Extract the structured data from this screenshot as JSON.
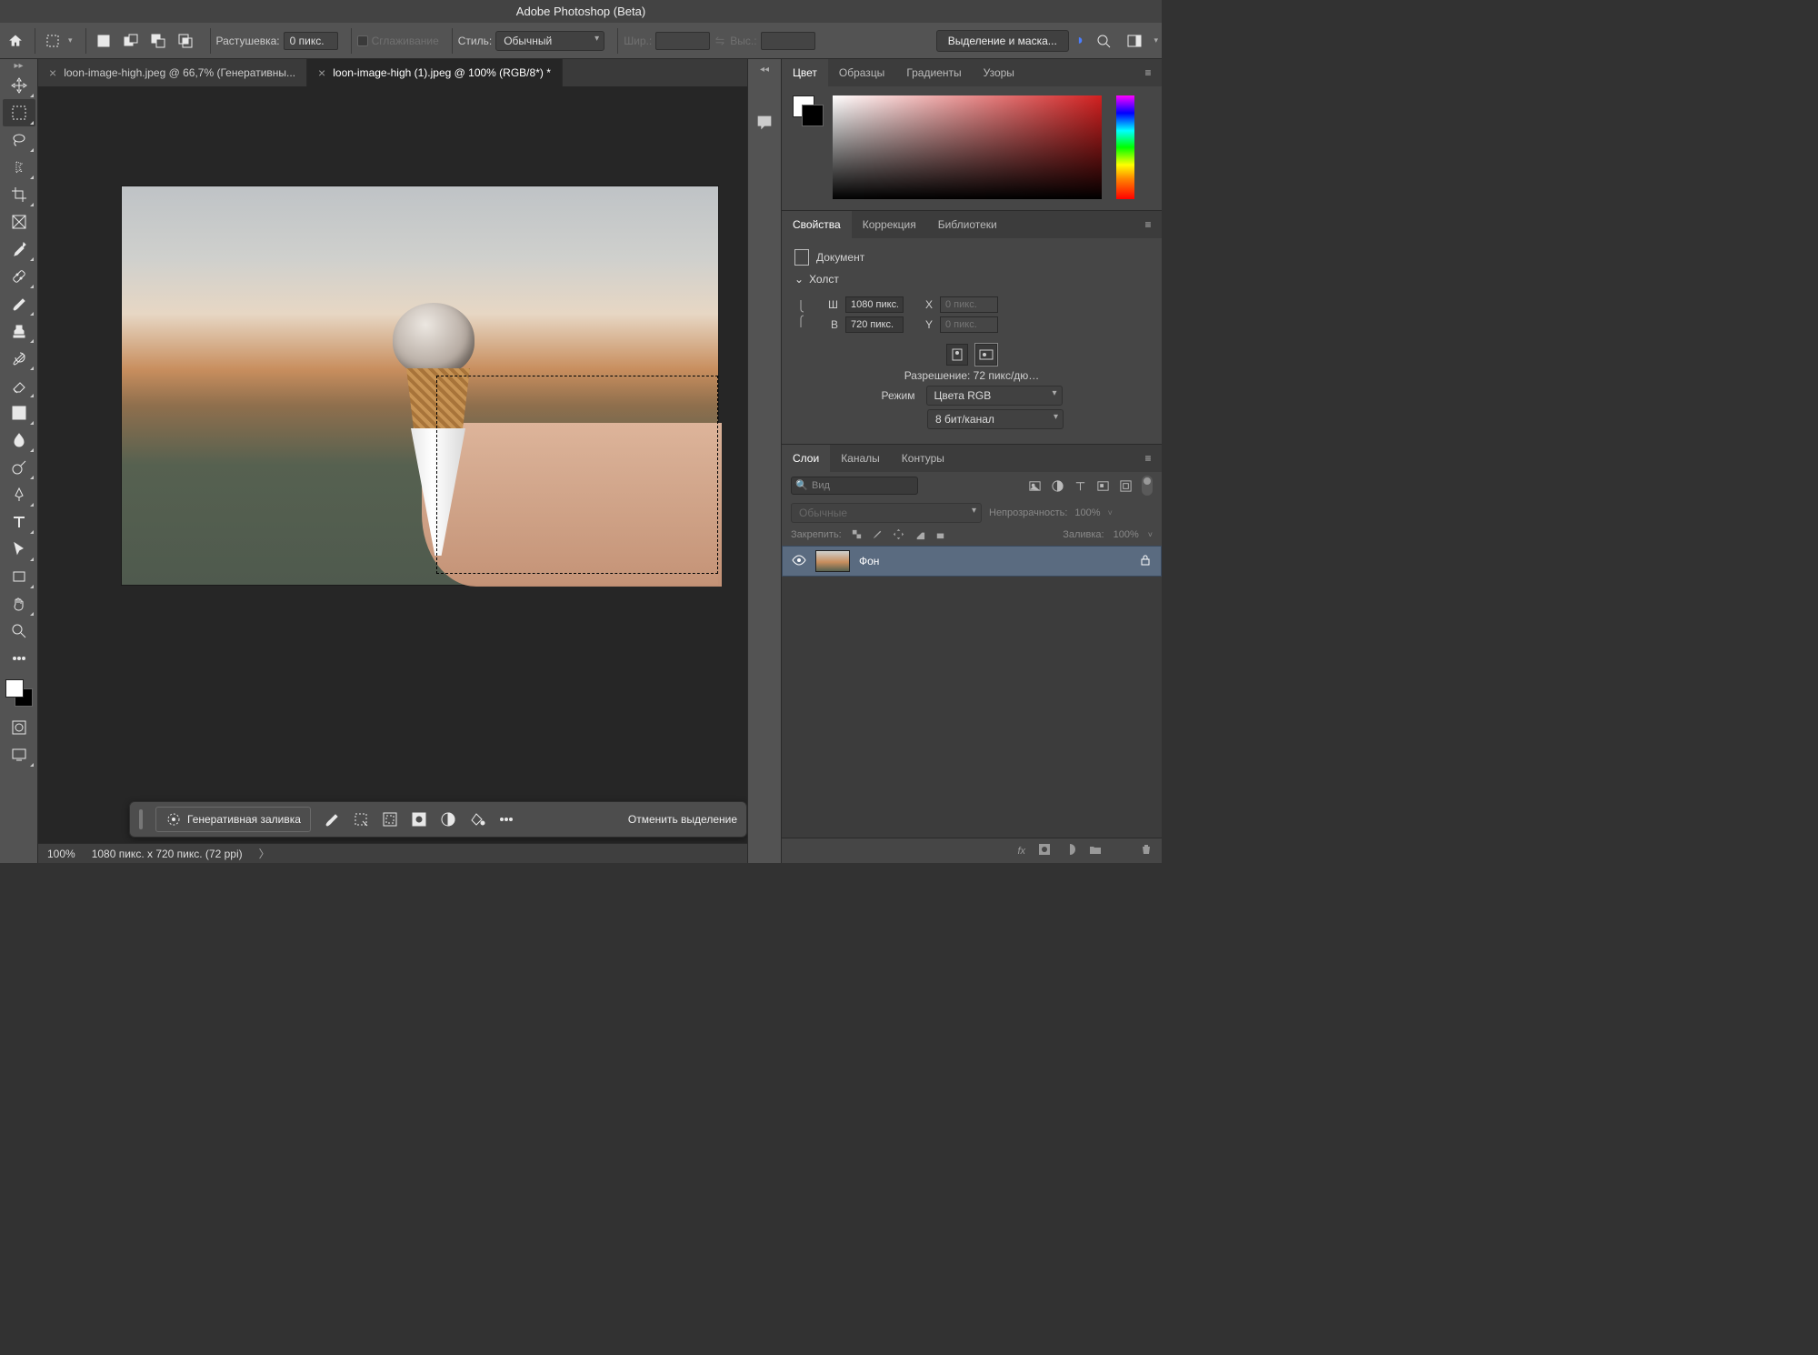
{
  "app": {
    "title": "Adobe Photoshop (Beta)"
  },
  "options": {
    "feather_label": "Растушевка:",
    "feather_value": "0 пикс.",
    "antialias_label": "Сглаживание",
    "style_label": "Стиль:",
    "style_value": "Обычный",
    "width_label": "Шир.:",
    "height_label": "Выс.:",
    "select_mask_label": "Выделение и маска..."
  },
  "tabs": [
    {
      "label": "loon-image-high.jpeg @ 66,7% (Генеративны...",
      "active": false
    },
    {
      "label": "loon-image-high (1).jpeg @ 100% (RGB/8*) *",
      "active": true
    }
  ],
  "context": {
    "gen_fill": "Генеративная заливка",
    "cancel_sel": "Отменить выделение"
  },
  "status": {
    "zoom": "100%",
    "dims": "1080 пикс. x 720 пикс. (72 ppi)"
  },
  "panels": {
    "color_tabs": [
      "Цвет",
      "Образцы",
      "Градиенты",
      "Узоры"
    ],
    "props_tabs": [
      "Свойства",
      "Коррекция",
      "Библиотеки"
    ],
    "document_label": "Документ",
    "canvas_label": "Холст",
    "w_label": "Ш",
    "w_value": "1080 пикс.",
    "h_label": "В",
    "h_value": "720 пикс.",
    "x_label": "X",
    "x_placeholder": "0 пикс.",
    "y_label": "Y",
    "y_placeholder": "0 пикс.",
    "resolution": "Разрешение: 72 пикс/дю…",
    "mode_label": "Режим",
    "mode_value": "Цвета RGB",
    "depth_value": "8 бит/канал",
    "layers_tabs": [
      "Слои",
      "Каналы",
      "Контуры"
    ],
    "filter_kind": "Вид",
    "blend_value": "Обычные",
    "opacity_label": "Непрозрачность:",
    "opacity_value": "100%",
    "lock_label": "Закрепить:",
    "fill_label": "Заливка:",
    "fill_value": "100%",
    "layer_name": "Фон"
  }
}
